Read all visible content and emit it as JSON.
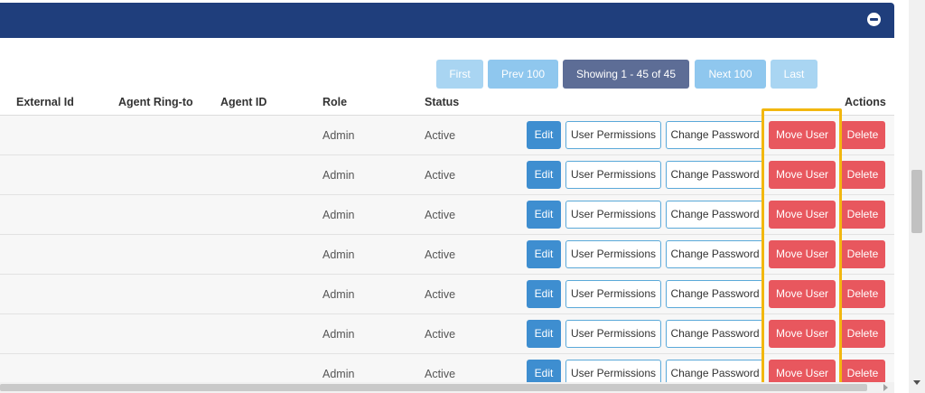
{
  "pagination": {
    "first": "First",
    "prev": "Prev 100",
    "showing": "Showing 1 - 45 of 45",
    "next": "Next 100",
    "last": "Last"
  },
  "table": {
    "columns": [
      "External Id",
      "Agent Ring-to",
      "Agent ID",
      "Role",
      "Status",
      "Actions"
    ],
    "rows": [
      {
        "role": "Admin",
        "status": "Active"
      },
      {
        "role": "Admin",
        "status": "Active"
      },
      {
        "role": "Admin",
        "status": "Active"
      },
      {
        "role": "Admin",
        "status": "Active"
      },
      {
        "role": "Admin",
        "status": "Active"
      },
      {
        "role": "Admin",
        "status": "Active"
      },
      {
        "role": "Admin",
        "status": "Active"
      }
    ],
    "actions": {
      "edit": "Edit",
      "permissions": "User Permissions",
      "change_password": "Change Password",
      "move": "Move User",
      "delete": "Delete"
    }
  },
  "colors": {
    "header": "#1f3e7c",
    "edit": "#3e8ed0",
    "danger": "#e8575e",
    "highlight": "#f2b70f"
  }
}
